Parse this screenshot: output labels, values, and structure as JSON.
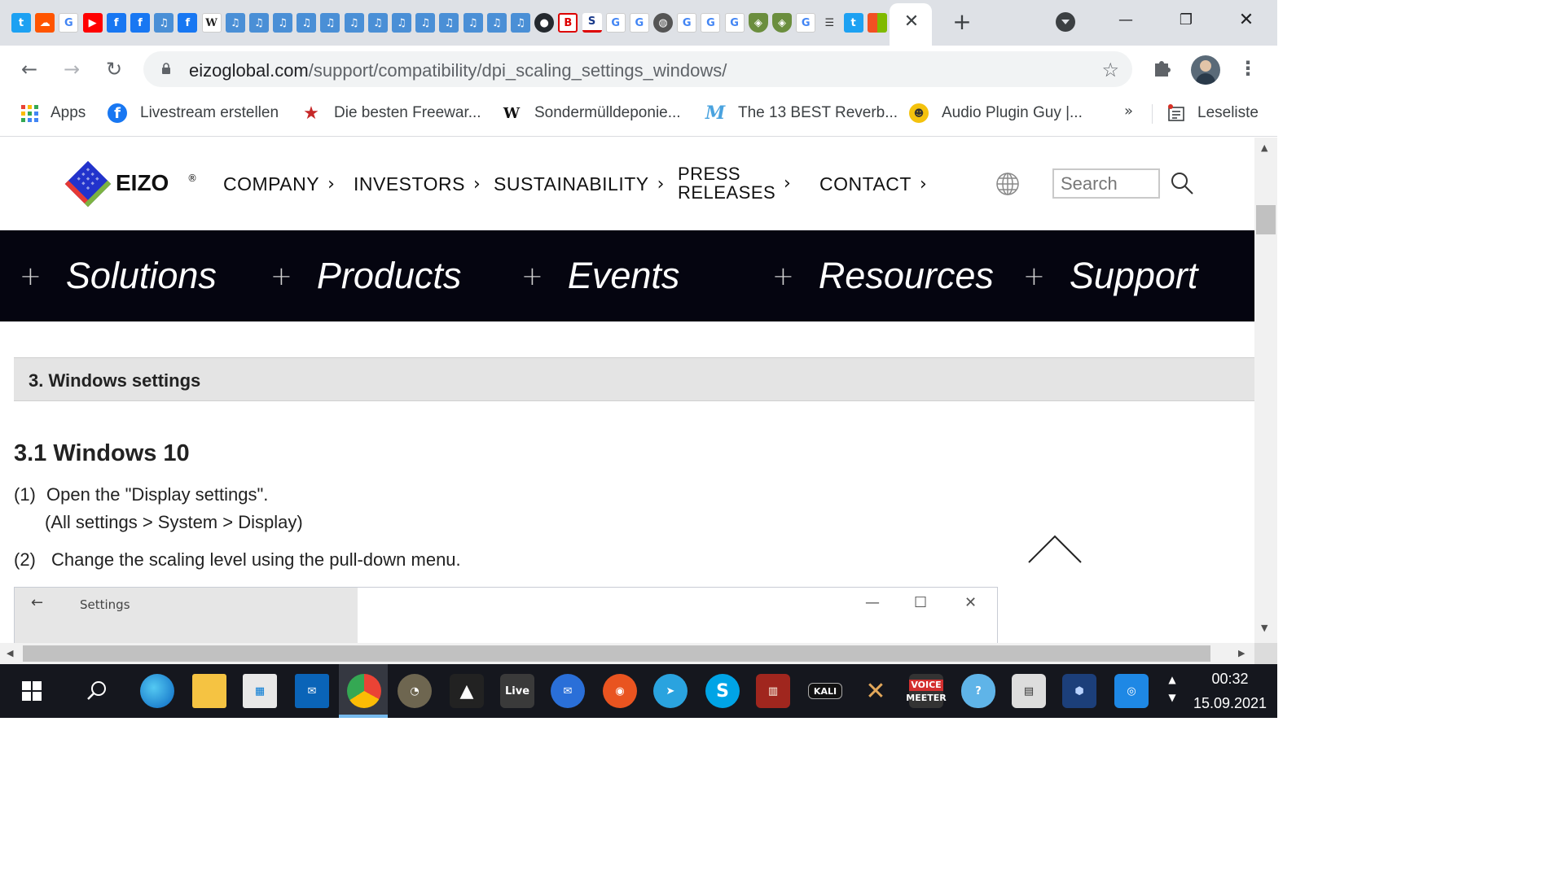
{
  "browser": {
    "tab_favicons": [
      "twitter",
      "soundcloud",
      "google",
      "youtube",
      "facebook",
      "facebook",
      "music-file",
      "facebook",
      "wikipedia",
      "music-file",
      "music-file",
      "music-file",
      "music-file",
      "music-file",
      "music-file",
      "music-file",
      "music-file",
      "music-file",
      "music-file",
      "music-file",
      "music-file",
      "music-file",
      "github",
      "b-site",
      "s-site",
      "google",
      "google",
      "world",
      "google",
      "google",
      "google",
      "shield",
      "shield",
      "google",
      "list",
      "twitter",
      "microsoft"
    ],
    "tab_close": "✕",
    "new_tab": "+",
    "address": {
      "host": "eizoglobal.com",
      "path": "/support/compatibility/dpi_scaling_settings_windows/"
    },
    "bookmarks": [
      {
        "icon": "apps-grid-icon",
        "label": "Apps"
      },
      {
        "icon": "facebook-icon",
        "label": "Livestream erstellen"
      },
      {
        "icon": "star-badge-icon",
        "label": "Die besten Freewar..."
      },
      {
        "icon": "wikipedia-icon",
        "label": "Sondermülldeponie..."
      },
      {
        "icon": "m-script-icon",
        "label": "The 13 BEST Reverb..."
      },
      {
        "icon": "face-icon",
        "label": "Audio Plugin Guy |..."
      }
    ],
    "bookmarks_more": "»",
    "reading_list": "Leseliste"
  },
  "site": {
    "logo_text": "EIZO",
    "nav": [
      {
        "label": "COMPANY"
      },
      {
        "label": "INVESTORS"
      },
      {
        "label": "SUSTAINABILITY"
      },
      {
        "label": "PRESS RELEASES"
      },
      {
        "label": "CONTACT"
      }
    ],
    "press_line1": "PRESS",
    "press_line2": "RELEASES",
    "chevron": "›",
    "search_placeholder": "Search",
    "mega": [
      "Solutions",
      "Products",
      "Events",
      "Resources",
      "Support"
    ],
    "mega_plus": "+"
  },
  "content": {
    "section_title": "3. Windows settings",
    "sub_heading": "3.1 Windows 10",
    "steps": [
      {
        "num": "(1)",
        "text": "Open the \"Display settings\".",
        "sub": "(All settings > System > Display)"
      },
      {
        "num": "(2)",
        "text": "Change the scaling level using the pull-down menu."
      }
    ],
    "settings_window": {
      "back": "←",
      "title": "Settings",
      "min": "—",
      "max": "☐",
      "close": "✕"
    }
  },
  "taskbar": {
    "apps": [
      "windows-start",
      "search",
      "edge",
      "file-explorer",
      "store",
      "mail",
      "chrome",
      "gimp",
      "inkscape",
      "ableton-live",
      "thunderbird",
      "ubuntu",
      "telegram",
      "skype",
      "mixer",
      "kali",
      "x-app",
      "voicemeeter",
      "onedrive",
      "hardware",
      "virtualbox",
      "screen-capture"
    ],
    "live_label": "Live",
    "kali_label": "KALI",
    "voicemeeter_line1": "VOICE",
    "voicemeeter_line2": "MEETER",
    "time": "00:32",
    "date": "15.09.2021"
  },
  "colors": {
    "chrome_tabstrip": "#dee1e6",
    "mega_nav_bg": "#050510",
    "section_bar_bg": "#e4e4e4",
    "taskbar_bg": "#15171e",
    "eizo_blue": "#1a1aa6"
  }
}
